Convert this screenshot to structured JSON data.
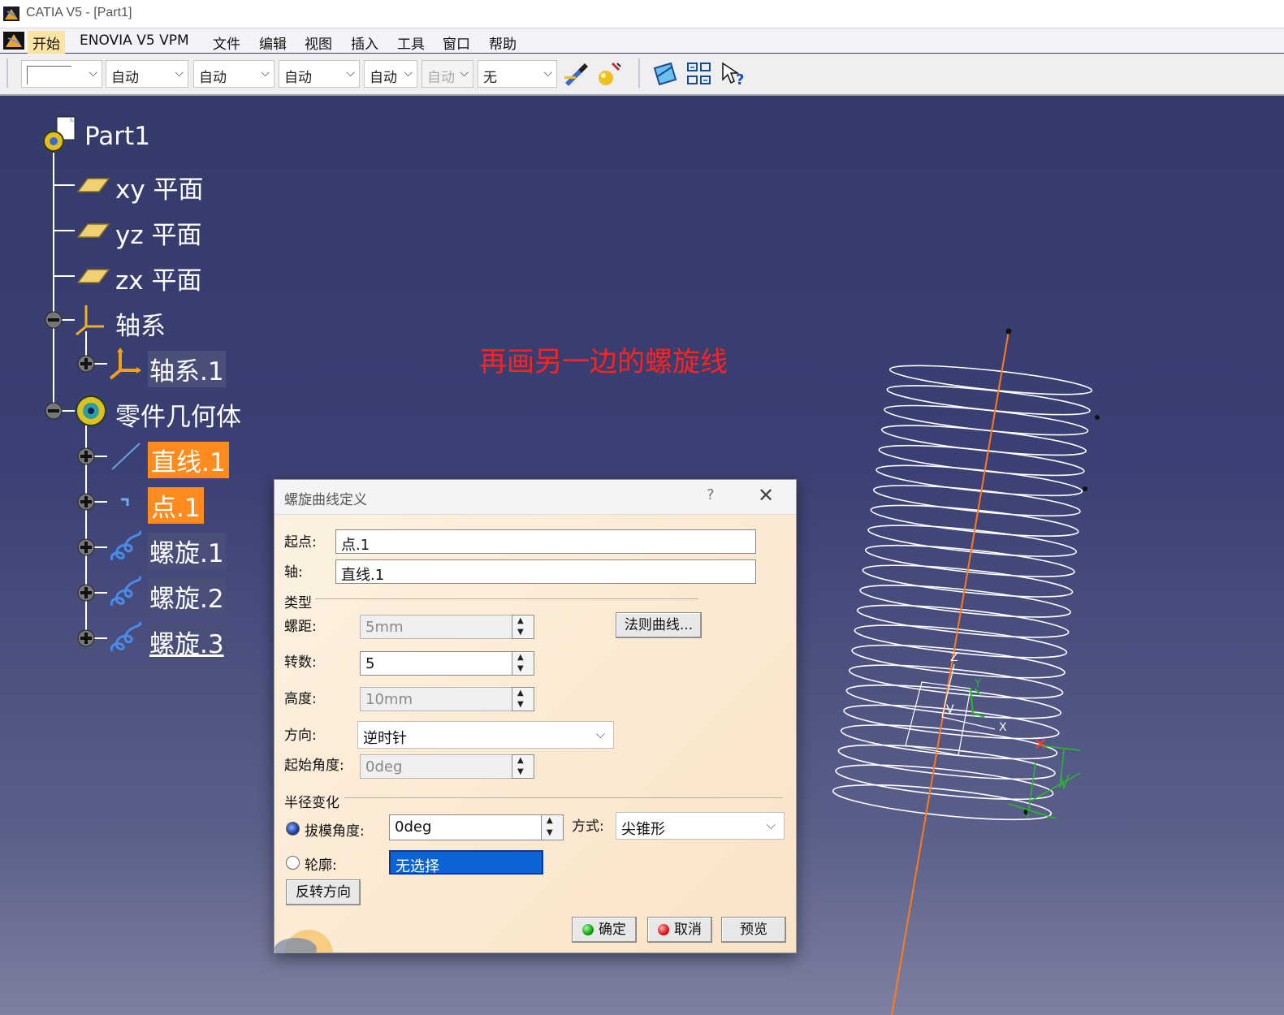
{
  "window": {
    "title": "CATIA V5 - [Part1]"
  },
  "menu": {
    "items": [
      "开始",
      "ENOVIA V5 VPM",
      "文件",
      "编辑",
      "视图",
      "插入",
      "工具",
      "窗口",
      "帮助"
    ]
  },
  "toolbar": {
    "combos": [
      "自动",
      "自动",
      "自动",
      "自动",
      "自动",
      "无"
    ]
  },
  "tree": {
    "root": "Part1",
    "items": [
      "xy 平面",
      "yz 平面",
      "zx 平面",
      "轴系",
      "轴系.1",
      "零件几何体",
      "直线.1",
      "点.1",
      "螺旋.1",
      "螺旋.2",
      "螺旋.3"
    ]
  },
  "annotation": "再画另一边的螺旋线",
  "viewport_labels": {
    "z": "Z",
    "y": "Y",
    "x": "X",
    "v": "V"
  },
  "dialog": {
    "title": "螺旋曲线定义",
    "help": "?",
    "close": "✕",
    "start_label": "起点:",
    "start_value": "点.1",
    "axis_label": "轴:",
    "axis_value": "直线.1",
    "type_section": "类型",
    "pitch_label": "螺距:",
    "pitch_value": "5mm",
    "law_button": "法则曲线...",
    "turns_label": "转数:",
    "turns_value": "5",
    "height_label": "高度:",
    "height_value": "10mm",
    "direction_label": "方向:",
    "direction_value": "逆时针",
    "start_angle_label": "起始角度:",
    "start_angle_value": "0deg",
    "radius_section": "半径变化",
    "draft_label": "拔模角度:",
    "draft_value": "0deg",
    "mode_label": "方式:",
    "mode_value": "尖锥形",
    "profile_label": "轮廓:",
    "profile_value": "无选择",
    "reverse_button": "反转方向",
    "ok_button": "确定",
    "cancel_button": "取消",
    "preview_button": "预览"
  },
  "colors": {
    "viewport_bg": "#3a3f6e",
    "highlight": "#ff8a1d",
    "annotation": "#ff2020",
    "axis_line": "#ff7a1a",
    "helix": "#ffffff",
    "dims": "#20c020"
  }
}
